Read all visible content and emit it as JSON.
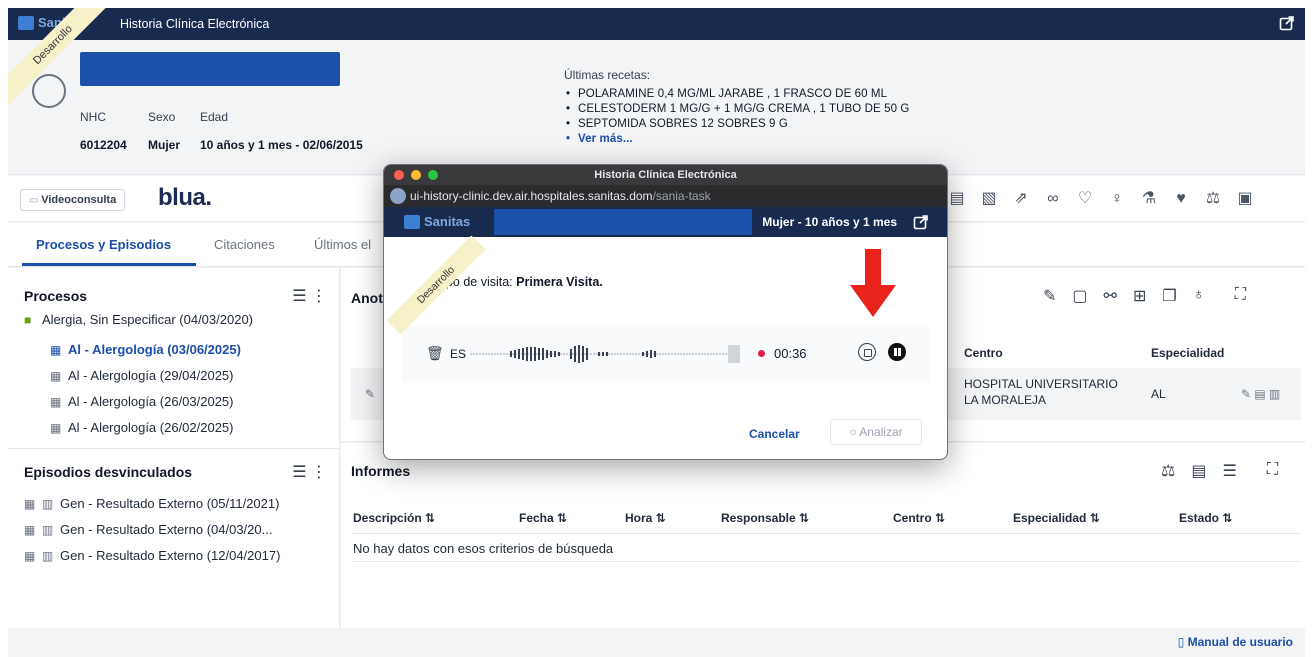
{
  "app": {
    "brand": "Sanitas",
    "title": "Historia Clínica Electrónica",
    "env_ribbon": "Desarrollo"
  },
  "patient": {
    "labels": {
      "nhc": "NHC",
      "sexo": "Sexo",
      "edad": "Edad"
    },
    "values": {
      "nhc": "6012204",
      "sexo": "Mujer",
      "edad": "10 años y 1 mes - 02/06/2015"
    }
  },
  "recetas": {
    "heading": "Últimas recetas:",
    "items": [
      "POLARAMINE 0,4 MG/ML JARABE , 1 FRASCO DE 60 ML",
      "CELESTODERM 1 MG/G + 1 MG/G CREMA , 1 TUBO DE 50 G",
      "SEPTOMIDA SOBRES 12 SOBRES 9 G"
    ],
    "more": "Ver más..."
  },
  "toolbar": {
    "video_label": "Videoconsulta",
    "blua": "blua."
  },
  "tabs": [
    {
      "label": "Procesos y Episodios"
    },
    {
      "label": "Citaciones"
    },
    {
      "label": "Últimos el"
    }
  ],
  "procesos": {
    "title": "Procesos",
    "parent": "Alergia, Sin Especificar (04/03/2020)",
    "items": [
      "Al - Alergología (03/06/2025)",
      "Al - Alergología (29/04/2025)",
      "Al - Alergología (26/03/2025)",
      "Al - Alergología (26/02/2025)"
    ]
  },
  "episodios": {
    "title": "Episodios desvinculados",
    "items": [
      "Gen - Resultado Externo (05/11/2021)",
      "Gen - Resultado Externo (04/03/20...",
      "Gen - Resultado Externo (12/04/2017)"
    ]
  },
  "anotaciones": {
    "title": "Anot",
    "headers": {
      "centro": "Centro",
      "especialidad": "Especialidad"
    },
    "row": {
      "centro": "HOSPITAL UNIVERSITARIO LA MORALEJA",
      "especialidad": "AL"
    }
  },
  "informes": {
    "title": "Informes",
    "headers": [
      "Descripción",
      "Fecha",
      "Hora",
      "Responsable",
      "Centro",
      "Especialidad",
      "Estado"
    ],
    "empty": "No hay datos con esos criterios de búsqueda"
  },
  "footer": {
    "manual": "Manual de usuario"
  },
  "modal": {
    "window_title": "Historia Clínica Electrónica",
    "url_host": "ui-history-clinic.dev.air.hospitales.sanitas.dom",
    "url_path": "/sania-task",
    "patient_info": "Mujer - 10 años y 1 mes",
    "visit_prefix": "Tipo de visita: ",
    "visit_type": "Primera Visita.",
    "lang": "ES",
    "timer": "00:36",
    "cancel": "Cancelar",
    "analizar": "Analizar"
  },
  "colors": {
    "navy": "#182a4e",
    "accent": "#1b4fa8",
    "record": "#e11d48",
    "arrow": "#e8231c"
  }
}
